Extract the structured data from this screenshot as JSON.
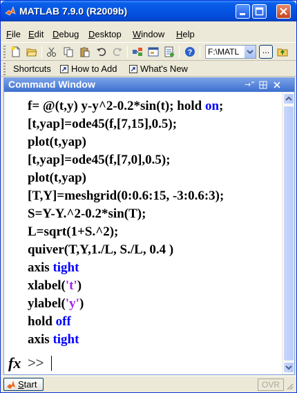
{
  "window": {
    "title": "MATLAB  7.9.0 (R2009b)"
  },
  "menu": [
    {
      "u": "F",
      "rest": "ile"
    },
    {
      "u": "E",
      "rest": "dit"
    },
    {
      "u": "D",
      "rest": "ebug"
    },
    {
      "u": "D",
      "rest": "esktop"
    },
    {
      "u": "W",
      "rest": "indow"
    },
    {
      "u": "H",
      "rest": "elp"
    }
  ],
  "toolbar": {
    "current_directory": "F:\\MATL",
    "browse_label": "..."
  },
  "shortcuts": {
    "label": "Shortcuts",
    "how_to_add": "How to Add",
    "whats_new": "What's New"
  },
  "command_window": {
    "title": "Command Window",
    "lines": [
      [
        {
          "t": "f= @(t,y) y-y^2-0.2*sin(t); hold ",
          "c": ""
        },
        {
          "t": "on",
          "c": "kw"
        },
        {
          "t": ";",
          "c": ""
        }
      ],
      [
        {
          "t": "[t,yap]=ode45(f,[7,15],0.5);",
          "c": ""
        }
      ],
      [
        {
          "t": "plot(t,yap)",
          "c": ""
        }
      ],
      [
        {
          "t": "[t,yap]=ode45(f,[7,0],0.5);",
          "c": ""
        }
      ],
      [
        {
          "t": "plot(t,yap)",
          "c": ""
        }
      ],
      [
        {
          "t": "[T,Y]=meshgrid(0:0.6:15, -3:0.6:3);",
          "c": ""
        }
      ],
      [
        {
          "t": "S=Y-Y.^2-0.2*sin(T);",
          "c": ""
        }
      ],
      [
        {
          "t": "L=sqrt(1+S.^2);",
          "c": ""
        }
      ],
      [
        {
          "t": "quiver(T,Y,1./L, S./L, 0.4 )",
          "c": ""
        }
      ],
      [
        {
          "t": "axis ",
          "c": ""
        },
        {
          "t": "tight",
          "c": "kw"
        }
      ],
      [
        {
          "t": "xlabel(",
          "c": ""
        },
        {
          "t": "'t'",
          "c": "str"
        },
        {
          "t": ")",
          "c": ""
        }
      ],
      [
        {
          "t": "ylabel(",
          "c": ""
        },
        {
          "t": "'y'",
          "c": "str"
        },
        {
          "t": ")",
          "c": ""
        }
      ],
      [
        {
          "t": "hold ",
          "c": ""
        },
        {
          "t": "off",
          "c": "kw"
        }
      ],
      [
        {
          "t": "axis ",
          "c": ""
        },
        {
          "t": "tight",
          "c": "kw"
        }
      ]
    ],
    "fx_label": "fx",
    "prompt": ">>"
  },
  "statusbar": {
    "start_u": "S",
    "start_rest": "tart",
    "ovr": "OVR"
  }
}
